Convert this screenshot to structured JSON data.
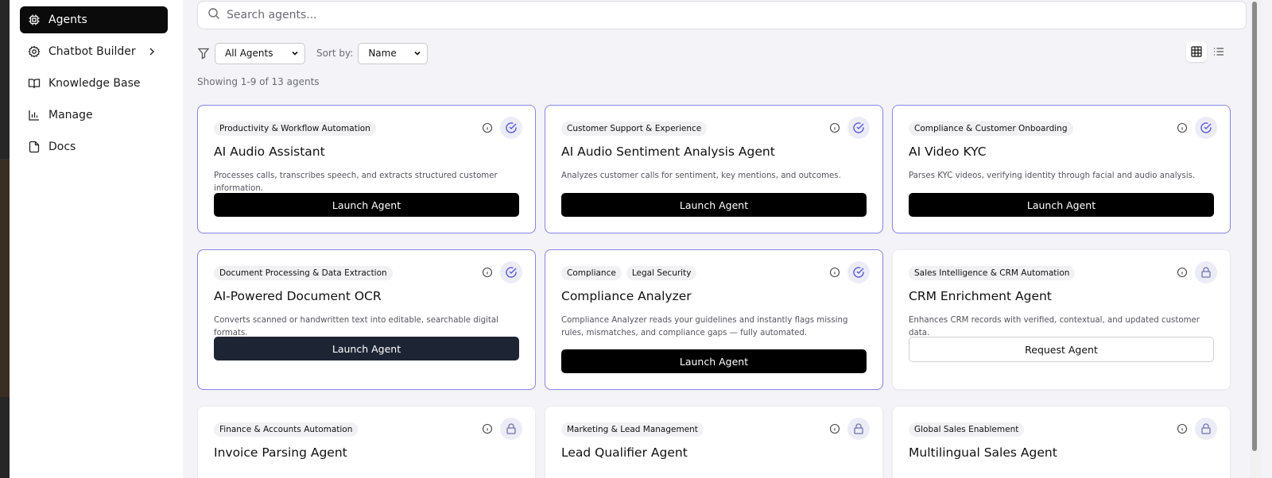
{
  "sidebar": {
    "items": [
      {
        "label": "Agents",
        "icon": "cpu-icon",
        "active": true
      },
      {
        "label": "Chatbot Builder",
        "icon": "gear-icon",
        "has_submenu": true
      },
      {
        "label": "Knowledge Base",
        "icon": "book-icon"
      },
      {
        "label": "Manage",
        "icon": "bar-chart-icon"
      },
      {
        "label": "Docs",
        "icon": "document-icon"
      }
    ]
  },
  "search": {
    "placeholder": "Search agents..."
  },
  "filters": {
    "category_selected": "All Agents",
    "sort_label": "Sort by:",
    "sort_selected": "Name"
  },
  "view": {
    "active": "grid"
  },
  "results_text": "Showing 1-9 of 13 agents",
  "colors": {
    "accent_border": "#8a86ea",
    "button_dark": "#000000",
    "sidebar_active": "#0b0b0b"
  },
  "cards": [
    {
      "tags": [
        "Productivity & Workflow Automation"
      ],
      "title": "AI Audio Assistant",
      "description": "Processes calls, transcribes speech, and extracts structured customer information.",
      "button": "Launch Agent",
      "status": "check-circle-icon"
    },
    {
      "tags": [
        "Customer Support & Experience"
      ],
      "title": "AI Audio Sentiment Analysis Agent",
      "description": "Analyzes customer calls for sentiment, key mentions, and outcomes.",
      "button": "Launch Agent",
      "status": "check-circle-icon"
    },
    {
      "tags": [
        "Compliance & Customer Onboarding"
      ],
      "title": "AI Video KYC",
      "description": "Parses KYC videos, verifying identity through facial and audio analysis.",
      "button": "Launch Agent",
      "status": "check-circle-icon"
    },
    {
      "tags": [
        "Document Processing & Data Extraction"
      ],
      "title": "AI-Powered Document OCR",
      "description": "Converts scanned or handwritten text into editable, searchable digital formats.",
      "button": "Launch Agent",
      "status": "check-circle-icon"
    },
    {
      "tags": [
        "Compliance",
        "Legal Security"
      ],
      "title": "Compliance Analyzer",
      "description": "Compliance Analyzer reads your guidelines and instantly flags missing rules, mismatches, and compliance gaps — fully automated.",
      "button": "Launch Agent",
      "status": "check-circle-icon"
    },
    {
      "tags": [
        "Sales Intelligence & CRM Automation"
      ],
      "title": "CRM Enrichment Agent",
      "description": "Enhances CRM records with verified, contextual, and updated customer data.",
      "button": "Request Agent",
      "status": "lock-icon"
    },
    {
      "tags": [
        "Finance & Accounts Automation"
      ],
      "title": "Invoice Parsing Agent",
      "status": "lock-icon"
    },
    {
      "tags": [
        "Marketing & Lead Management"
      ],
      "title": "Lead Qualifier Agent",
      "status": "lock-icon"
    },
    {
      "tags": [
        "Global Sales Enablement"
      ],
      "title": "Multilingual Sales Agent",
      "status": "lock-icon"
    }
  ]
}
